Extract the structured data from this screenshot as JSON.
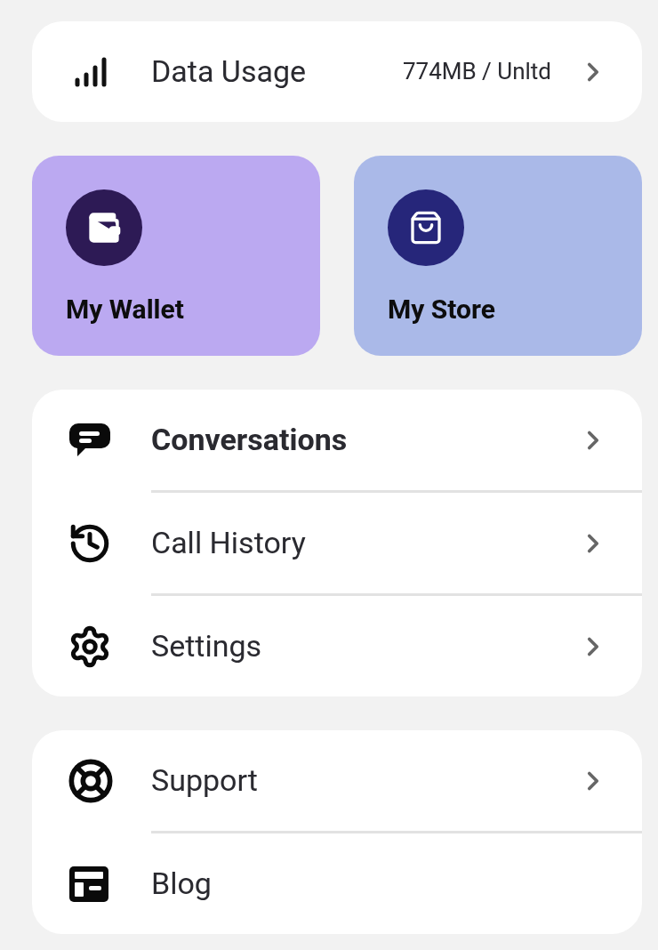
{
  "data_usage": {
    "label": "Data Usage",
    "value": "774MB / Unltd"
  },
  "tiles": [
    {
      "label": "My Wallet",
      "color": "#bba9f1"
    },
    {
      "label": "My Store",
      "color": "#aab9e8"
    }
  ],
  "menu": [
    {
      "label": "Conversations",
      "unread": true,
      "chevron": true
    },
    {
      "label": "Call History",
      "unread": false,
      "chevron": true
    },
    {
      "label": "Settings",
      "unread": false,
      "chevron": true
    }
  ],
  "help_menu": [
    {
      "label": "Support",
      "chevron": true
    },
    {
      "label": "Blog",
      "chevron": false
    }
  ]
}
